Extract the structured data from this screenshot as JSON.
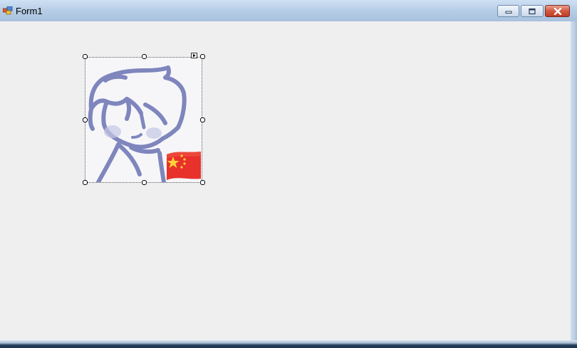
{
  "window": {
    "title": "Form1",
    "app_icon": "winforms-form-icon",
    "caption_buttons": [
      {
        "name": "minimize-button",
        "icon": "minimize-icon"
      },
      {
        "name": "maximize-button",
        "icon": "maximize-icon"
      },
      {
        "name": "close-button",
        "icon": "close-icon"
      }
    ]
  },
  "designer": {
    "selected_control": "PictureBox",
    "smart_tag_icon": "smart-tag-arrow-icon",
    "image_icon": "cartoon-boy-with-china-flag-image"
  },
  "colors": {
    "client_background": "#efefef",
    "title_gradient_top": "#cfe0f3",
    "title_gradient_bottom": "#a8c1de",
    "close_button": "#c9442c",
    "drawing_stroke": "#7f86bd",
    "flag_red": "#e8312a",
    "flag_star": "#ffd23a"
  }
}
